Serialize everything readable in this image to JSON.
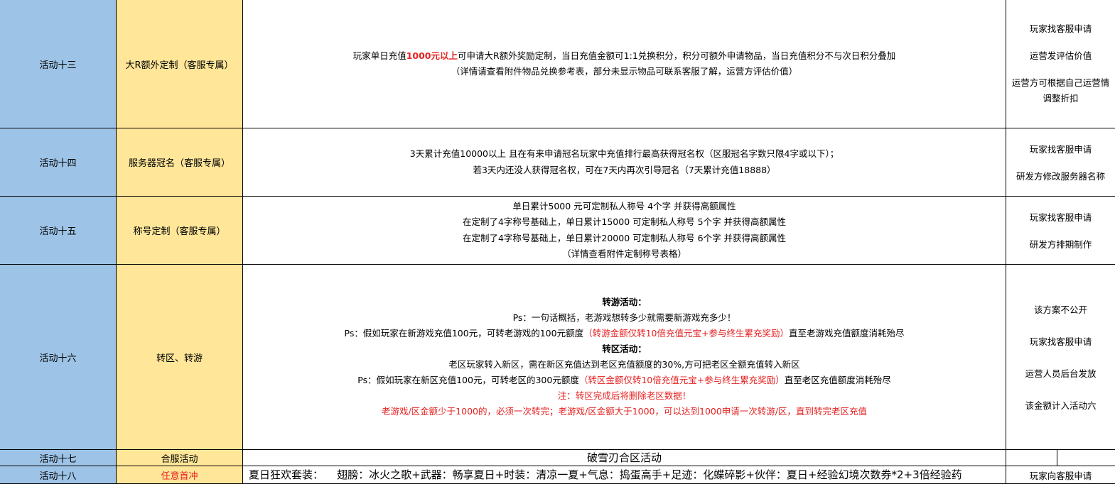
{
  "colors": {
    "name_col": "#9dc3e6",
    "title_col": "#ffe699",
    "red_text": "#e52222"
  },
  "rows": [
    {
      "name": "活动十三",
      "title": "大R额外定制（客服专属）",
      "desc_l1_a": "玩家单日充值",
      "desc_l1_b": "1000元以上",
      "desc_l1_c": "可申请大R额外奖励定制，当日充值金额可1:1兑换积分，积分可额外申请物品，当日充值积分不与次日积分叠加",
      "desc_l2": "（详情请查看附件物品兑换参考表，部分未显示物品可联系客服了解，运营方评估价值）",
      "notes": [
        "玩家找客服申请",
        "运营发评估价值",
        "运营方可根据自己运营情",
        "调整折扣"
      ]
    },
    {
      "name": "活动十四",
      "title": "服务器冠名（客服专属）",
      "desc_l1": "3天累计充值10000以上 且在有来申请冠名玩家中充值排行最高获得冠名权（区服冠名字数只限4字或以下）；",
      "desc_l2": "若3天内还没人获得冠名权，可在7天内再次引导冠名（7天累计充值18888）",
      "notes": [
        "玩家找客服申请",
        "研发方修改服务器名称"
      ]
    },
    {
      "name": "活动十五",
      "title": "称号定制（客服专属）",
      "desc_l1": "单日累计5000 元可定制私人称号 4个字 并获得高额属性",
      "desc_l2": "在定制了4字称号基础上，单日累计15000 可定制私人称号 5个字 并获得高额属性",
      "desc_l3": "在定制了4字称号基础上，单日累计20000 可定制私人称号 6个字 并获得高额属性",
      "desc_l4": "（详情查看附件定制称号表格）",
      "notes": [
        "玩家找客服申请",
        "研发方排期制作"
      ]
    },
    {
      "name": "活动十六",
      "title": "转区、转游",
      "desc_h1": "转游活动：",
      "desc_l1": "Ps：一句话概括，老游戏想转多少就需要新游戏充多少！",
      "desc_l2_a": "Ps：假如玩家在新游戏充值100元，可转老游戏的100元额度",
      "desc_l2_b": "（转游金额仅转10倍充值元宝+参与终生累充奖励）",
      "desc_l2_c": "直至老游戏充值额度消耗殆尽",
      "desc_h2": "转区活动：",
      "desc_l3": "老区玩家转入新区，需在新区充值达到老区充值额度的30%,方可把老区全额充值转入新区",
      "desc_l4_a": "Ps：假如玩家在新区充值100元，可转老区的300元额度",
      "desc_l4_b": "（转区金额仅转10倍充值元宝+参与终生累充奖励）",
      "desc_l4_c": "直至老区充值额度消耗殆尽",
      "desc_l5": "注：转区完成后将删除老区数据！",
      "desc_l6": "老游戏/区金额少于1000的，必须一次转完；老游戏/区金额大于1000，可以达到1000申请一次转游/区，直到转完老区充值",
      "notes": [
        "该方案不公开",
        "玩家找客服申请",
        "运营人员后台发放",
        "该金额计入活动六"
      ]
    },
    {
      "name": "活动十七",
      "title": "合服活动",
      "desc": "破雪刃合区活动",
      "notes": []
    },
    {
      "name": "活动十八",
      "title": "任意首冲",
      "desc": "夏日狂欢套装：    翅膀：冰火之歌+武器：畅享夏日+时装：清凉一夏+气息：捣蛋高手+足迹：化蝶碎影+伙伴：夏日+经验幻境次数券*2+3倍经验药",
      "notes": [
        "玩家向客服申请"
      ]
    }
  ]
}
